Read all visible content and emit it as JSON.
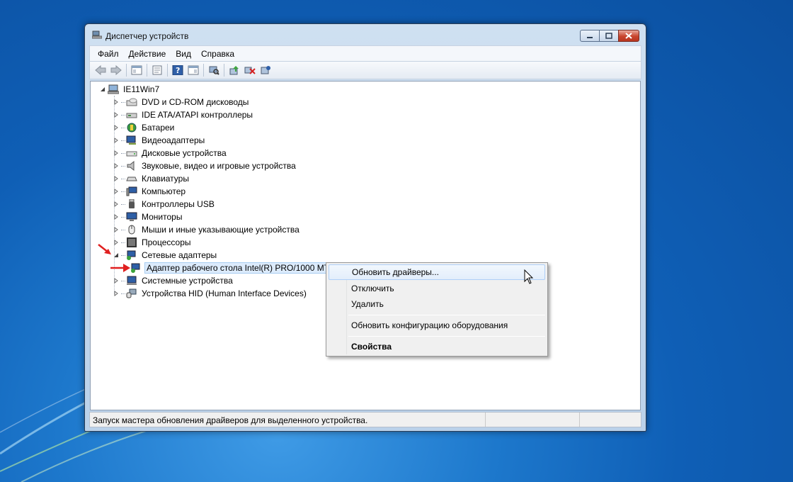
{
  "window": {
    "title": "Диспетчер устройств",
    "controls": {
      "minimize": "minimize",
      "maximize": "maximize",
      "close": "close"
    }
  },
  "menubar": {
    "items": [
      "Файл",
      "Действие",
      "Вид",
      "Справка"
    ]
  },
  "toolbar": {
    "buttons": [
      "back-icon",
      "forward-icon",
      "show-hide-console-tree-icon",
      "properties-icon",
      "help-icon",
      "view-icon",
      "scan-hardware-icon",
      "update-driver-icon",
      "disable-device-icon",
      "uninstall-icon"
    ]
  },
  "tree": {
    "root": "IE11Win7",
    "categories": [
      "DVD и CD-ROM дисководы",
      "IDE ATA/ATAPI контроллеры",
      "Батареи",
      "Видеоадаптеры",
      "Дисковые устройства",
      "Звуковые, видео и игровые устройства",
      "Клавиатуры",
      "Компьютер",
      "Контроллеры USB",
      "Мониторы",
      "Мыши и иные указывающие устройства",
      "Процессоры",
      "Сетевые адаптеры",
      "Системные устройства",
      "Устройства HID (Human Interface Devices)"
    ],
    "expanded_category": "Сетевые адаптеры",
    "selected_device": "Адаптер рабочего стола Intel(R) PRO/1000 MT"
  },
  "context_menu": {
    "items": [
      {
        "label": "Обновить драйверы...",
        "highlighted": true
      },
      {
        "label": "Отключить"
      },
      {
        "label": "Удалить"
      },
      {
        "label": "Обновить конфигурацию оборудования"
      },
      {
        "label": "Свойства",
        "bold": true
      }
    ]
  },
  "statusbar": {
    "text": "Запуск мастера обновления драйверов для выделенного устройства."
  },
  "colors": {
    "desktop": "#1d78cc",
    "annotation_arrow": "#e02020",
    "selection": "#dcebfc"
  }
}
